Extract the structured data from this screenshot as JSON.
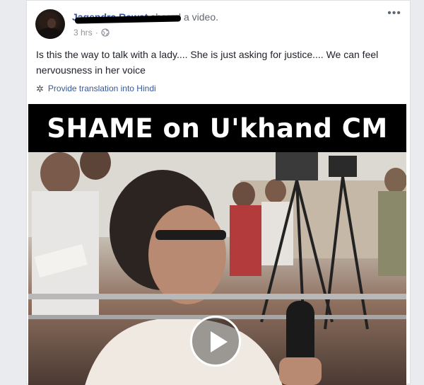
{
  "post": {
    "author_name": "Jagendra Rawat",
    "action": "shared a video.",
    "timestamp": "3 hrs",
    "privacy_icon": "globe-icon",
    "menu_icon": "more-options-icon",
    "text": "Is this the way to talk with a lady.... She is just asking for justice.... We can feel nervousness in her voice",
    "translation_link": "Provide translation into Hindi"
  },
  "video": {
    "banner_text": "SHAME on U'khand CM",
    "play_icon": "play-icon"
  },
  "colors": {
    "link": "#365899",
    "text": "#1d2129",
    "muted": "#90949c",
    "background": "#e9ebee",
    "card": "#ffffff"
  }
}
